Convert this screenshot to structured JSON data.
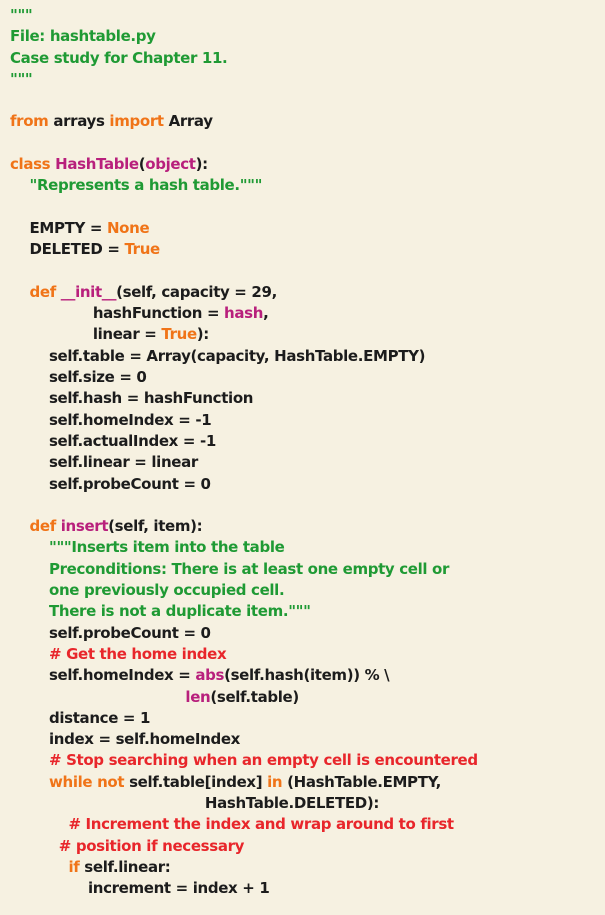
{
  "code": {
    "colors": {
      "g": "#1f9a34",
      "o": "#f07418",
      "p": "#b8207c",
      "r": "#e8262b",
      "d": "#1c1c1c"
    },
    "lines": [
      [
        [
          "g",
          "\"\"\""
        ]
      ],
      [
        [
          "g",
          "File: hashtable.py"
        ]
      ],
      [
        [
          "g",
          "Case study for Chapter 11."
        ]
      ],
      [
        [
          "g",
          "\"\"\""
        ]
      ],
      [],
      [
        [
          "o",
          "from"
        ],
        [
          "d",
          " arrays "
        ],
        [
          "o",
          "import"
        ],
        [
          "d",
          " Array"
        ]
      ],
      [],
      [
        [
          "o",
          "class"
        ],
        [
          "d",
          " "
        ],
        [
          "p",
          "HashTable"
        ],
        [
          "d",
          "("
        ],
        [
          "p",
          "object"
        ],
        [
          "d",
          "):"
        ]
      ],
      [
        [
          "d",
          "    "
        ],
        [
          "g",
          "\"Represents a hash table.\"\"\""
        ]
      ],
      [],
      [
        [
          "d",
          "    EMPTY = "
        ],
        [
          "o",
          "None"
        ]
      ],
      [
        [
          "d",
          "    DELETED = "
        ],
        [
          "o",
          "True"
        ]
      ],
      [],
      [
        [
          "d",
          "    "
        ],
        [
          "o",
          "def"
        ],
        [
          "d",
          " "
        ],
        [
          "p",
          "__init__"
        ],
        [
          "d",
          "(self, capacity = 29,"
        ]
      ],
      [
        [
          "d",
          "                 hashFunction = "
        ],
        [
          "p",
          "hash"
        ],
        [
          "d",
          ","
        ]
      ],
      [
        [
          "d",
          "                 linear = "
        ],
        [
          "o",
          "True"
        ],
        [
          "d",
          "):"
        ]
      ],
      [
        [
          "d",
          "        self.table = Array(capacity, HashTable.EMPTY)"
        ]
      ],
      [
        [
          "d",
          "        self.size = 0"
        ]
      ],
      [
        [
          "d",
          "        self.hash = hashFunction"
        ]
      ],
      [
        [
          "d",
          "        self.homeIndex = -1"
        ]
      ],
      [
        [
          "d",
          "        self.actualIndex = -1"
        ]
      ],
      [
        [
          "d",
          "        self.linear = linear"
        ]
      ],
      [
        [
          "d",
          "        self.probeCount = 0"
        ]
      ],
      [],
      [
        [
          "d",
          "    "
        ],
        [
          "o",
          "def"
        ],
        [
          "d",
          " "
        ],
        [
          "p",
          "insert"
        ],
        [
          "d",
          "(self, item):"
        ]
      ],
      [
        [
          "d",
          "        "
        ],
        [
          "g",
          "\"\"\"Inserts item into the table"
        ]
      ],
      [
        [
          "d",
          "        "
        ],
        [
          "g",
          "Preconditions: There is at least one empty cell or"
        ]
      ],
      [
        [
          "d",
          "        "
        ],
        [
          "g",
          "one previously occupied cell."
        ]
      ],
      [
        [
          "d",
          "        "
        ],
        [
          "g",
          "There is not a duplicate item.\"\"\""
        ]
      ],
      [
        [
          "d",
          "        self.probeCount = 0"
        ]
      ],
      [
        [
          "d",
          "        "
        ],
        [
          "r",
          "# Get the home index"
        ]
      ],
      [
        [
          "d",
          "        self.homeIndex = "
        ],
        [
          "p",
          "abs"
        ],
        [
          "d",
          "(self.hash(item)) % \\"
        ]
      ],
      [
        [
          "d",
          "                                    "
        ],
        [
          "p",
          "len"
        ],
        [
          "d",
          "(self.table)"
        ]
      ],
      [
        [
          "d",
          "        distance = 1"
        ]
      ],
      [
        [
          "d",
          "        index = self.homeIndex"
        ]
      ],
      [
        [
          "d",
          "        "
        ],
        [
          "r",
          "# Stop searching when an empty cell is encountered"
        ]
      ],
      [
        [
          "d",
          "        "
        ],
        [
          "o",
          "while not"
        ],
        [
          "d",
          " self.table[index] "
        ],
        [
          "o",
          "in"
        ],
        [
          "d",
          " (HashTable.EMPTY,"
        ]
      ],
      [
        [
          "d",
          "                                        HashTable.DELETED):"
        ]
      ],
      [
        [
          "d",
          "            "
        ],
        [
          "r",
          "# Increment the index and wrap around to first"
        ]
      ],
      [
        [
          "d",
          "          "
        ],
        [
          "r",
          "# position if necessary"
        ]
      ],
      [
        [
          "d",
          "            "
        ],
        [
          "o",
          "if"
        ],
        [
          "d",
          " self.linear:"
        ]
      ],
      [
        [
          "d",
          "                increment = index + 1"
        ]
      ]
    ]
  }
}
